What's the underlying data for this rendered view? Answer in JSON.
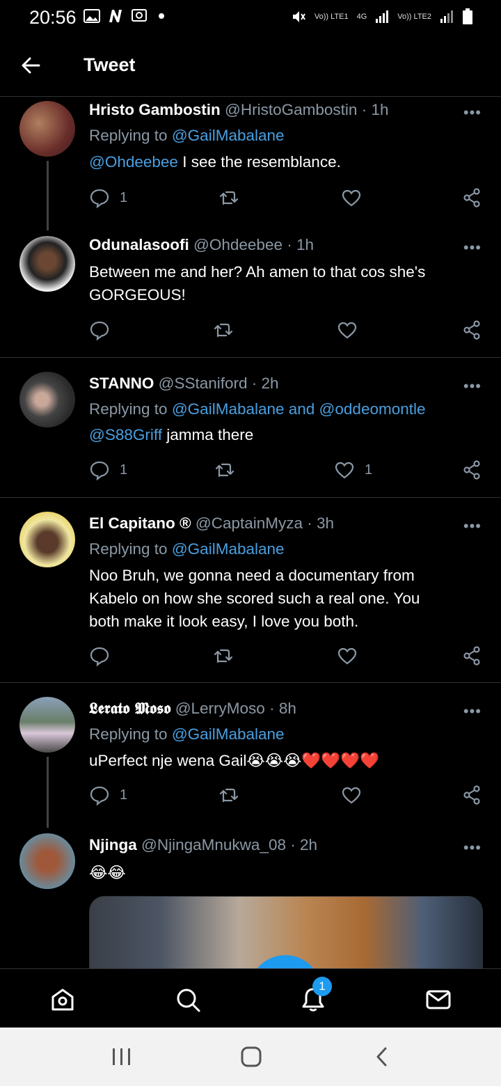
{
  "status_bar": {
    "time": "20:56",
    "right_labels": [
      "Vo)) LTE1",
      "4G",
      "Vo)) LTE2"
    ]
  },
  "header": {
    "title": "Tweet"
  },
  "tweets": [
    {
      "name": "Hristo Gambostin",
      "handle": "@HristoGambostin",
      "time": "· 1h",
      "reply_prefix": "Replying to",
      "reply_to": "@GailMabalane",
      "mention": "@Ohdeebee",
      "text": "I see the resemblance.",
      "reply_count": "1",
      "like_count": ""
    },
    {
      "name": "Odunalasoofi",
      "handle": "@Ohdeebee",
      "time": "· 1h",
      "text_line1": "Between me and her? Ah amen to that cos she's",
      "text_line2": "GORGEOUS!",
      "reply_count": "",
      "like_count": ""
    },
    {
      "name": "STANNO",
      "handle": "@SStaniford",
      "time": "· 2h",
      "reply_prefix": "Replying to",
      "reply_to": "@GailMabalane and @oddeomontle",
      "mention": "@S88Griff",
      "text": "jamma there",
      "reply_count": "1",
      "like_count": "1"
    },
    {
      "name": "El Capitano ®",
      "handle": "@CaptainMyza",
      "time": "· 3h",
      "reply_prefix": "Replying to",
      "reply_to": "@GailMabalane",
      "text_line1": "Noo Bruh, we gonna need a documentary from",
      "text_line2": "Kabelo on how she scored such a real one. You",
      "text_line3": "both make it look easy, I love you both.",
      "reply_count": "",
      "like_count": ""
    },
    {
      "name": "𝕷𝖊𝖗𝖆𝖙𝖔 𝕸𝖔𝖘𝖔",
      "handle": "@LerryMoso",
      "time": "· 8h",
      "reply_prefix": "Replying to",
      "reply_to": "@GailMabalane",
      "text": "uPerfect nje wena Gail😭😭😭❤️❤️❤️❤️",
      "reply_count": "1",
      "like_count": ""
    },
    {
      "name": "Njinga",
      "handle": "@NjingaMnukwa_08",
      "time": "· 2h",
      "text": "😂😂"
    }
  ],
  "bottom_nav": {
    "notification_badge": "1"
  },
  "icons": {
    "more": "more-dots-icon",
    "reply": "reply-bubble-icon",
    "retweet": "retweet-icon",
    "like": "heart-icon",
    "share": "share-icon"
  },
  "colors": {
    "accent": "#1d9bf0",
    "link": "#4a9fe0",
    "muted": "#8b98a5"
  }
}
